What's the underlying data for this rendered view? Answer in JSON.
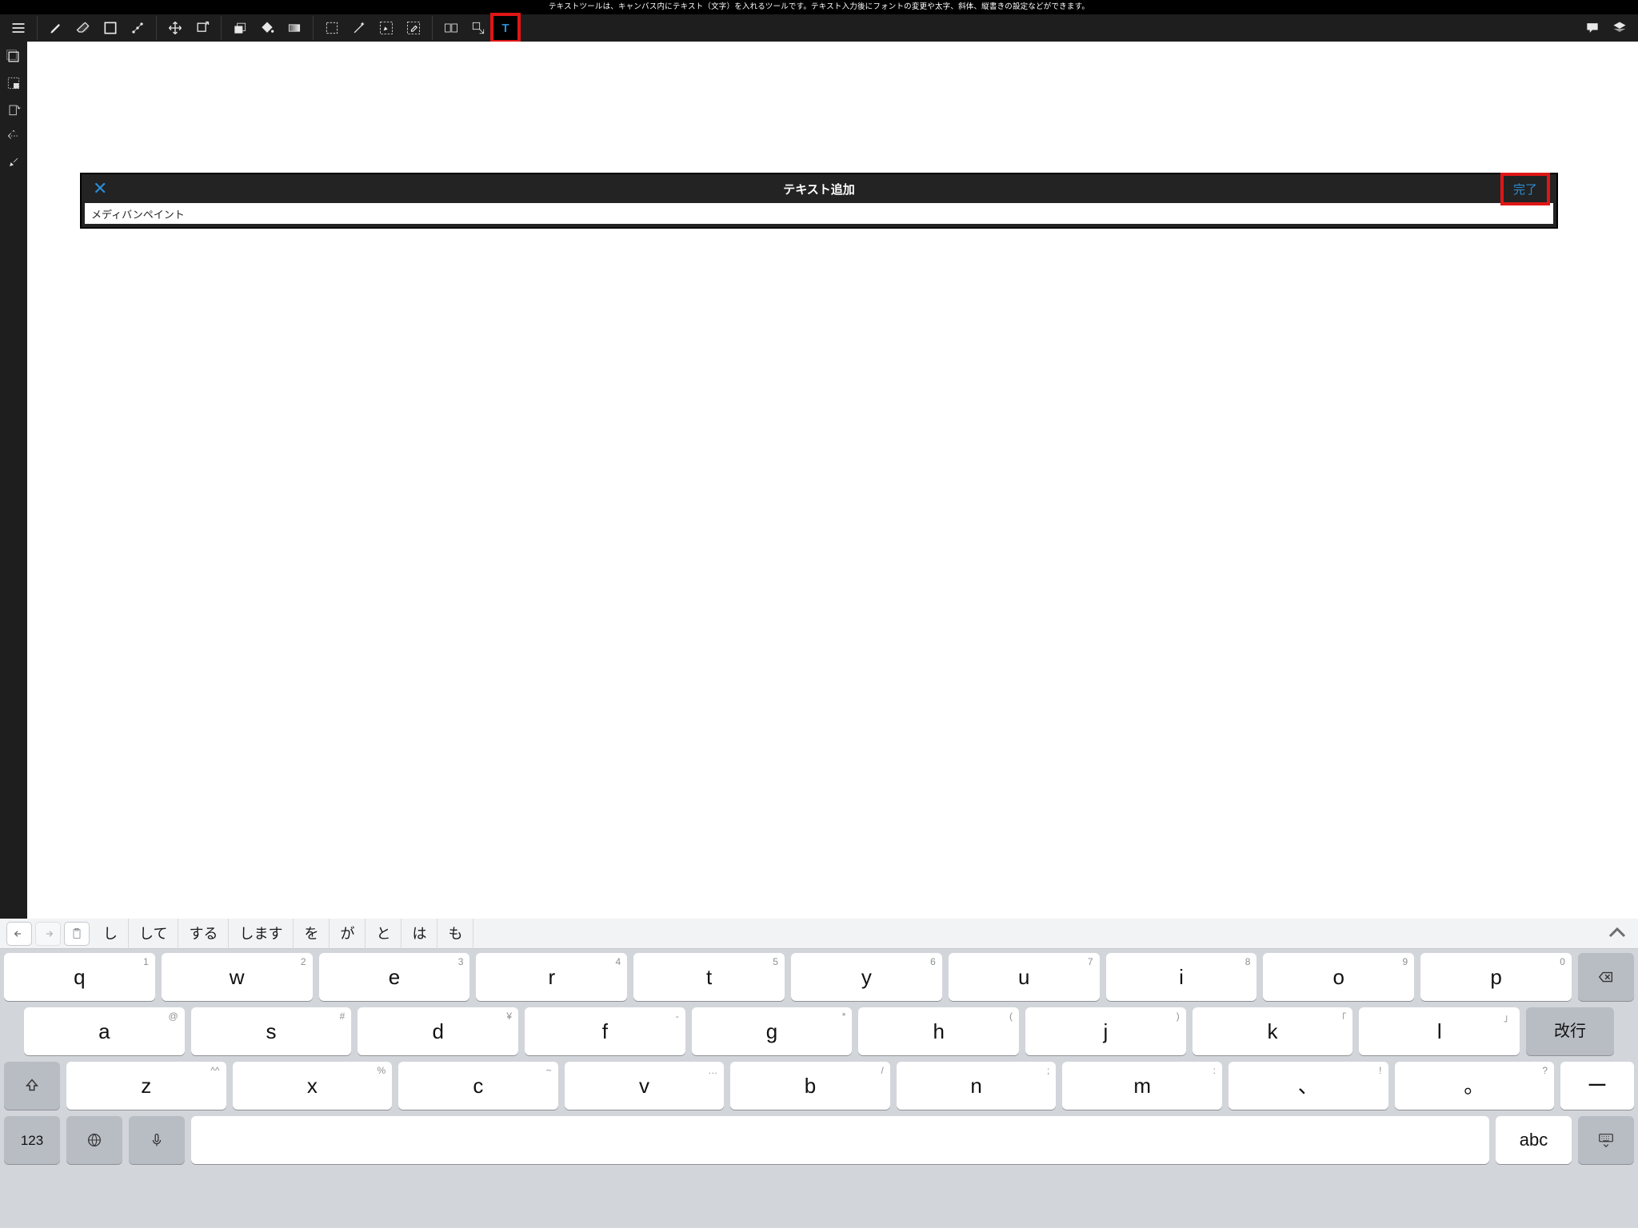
{
  "description": "テキストツールは、キャンバス内にテキスト（文字）を入れるツールです。テキスト入力後にフォントの変更や太字、斜体、縦書きの設定などができます。",
  "dialog": {
    "title": "テキスト追加",
    "done": "完了",
    "input_value": "メディバンペイント"
  },
  "candidates": [
    "し",
    "して",
    "する",
    "します",
    "を",
    "が",
    "と",
    "は",
    "も"
  ],
  "keys": {
    "row1": [
      {
        "m": "q",
        "h": "1"
      },
      {
        "m": "w",
        "h": "2"
      },
      {
        "m": "e",
        "h": "3"
      },
      {
        "m": "r",
        "h": "4"
      },
      {
        "m": "t",
        "h": "5"
      },
      {
        "m": "y",
        "h": "6"
      },
      {
        "m": "u",
        "h": "7"
      },
      {
        "m": "i",
        "h": "8"
      },
      {
        "m": "o",
        "h": "9"
      },
      {
        "m": "p",
        "h": "0"
      }
    ],
    "row2": [
      {
        "m": "a",
        "h": "@"
      },
      {
        "m": "s",
        "h": "#"
      },
      {
        "m": "d",
        "h": "¥"
      },
      {
        "m": "f",
        "h": "-"
      },
      {
        "m": "g",
        "h": "*"
      },
      {
        "m": "h",
        "h": "("
      },
      {
        "m": "j",
        "h": ")"
      },
      {
        "m": "k",
        "h": "「"
      },
      {
        "m": "l",
        "h": "」"
      }
    ],
    "enter_label": "改行",
    "row3": [
      {
        "m": "z",
        "h": "^^"
      },
      {
        "m": "x",
        "h": "%"
      },
      {
        "m": "c",
        "h": "~"
      },
      {
        "m": "v",
        "h": "…"
      },
      {
        "m": "b",
        "h": "/"
      },
      {
        "m": "n",
        "h": ";"
      },
      {
        "m": "m",
        "h": ":"
      },
      {
        "m": "、",
        "h": "!"
      },
      {
        "m": "。",
        "h": "?"
      }
    ],
    "dash": "ー",
    "nums": "123",
    "abc": "abc"
  }
}
